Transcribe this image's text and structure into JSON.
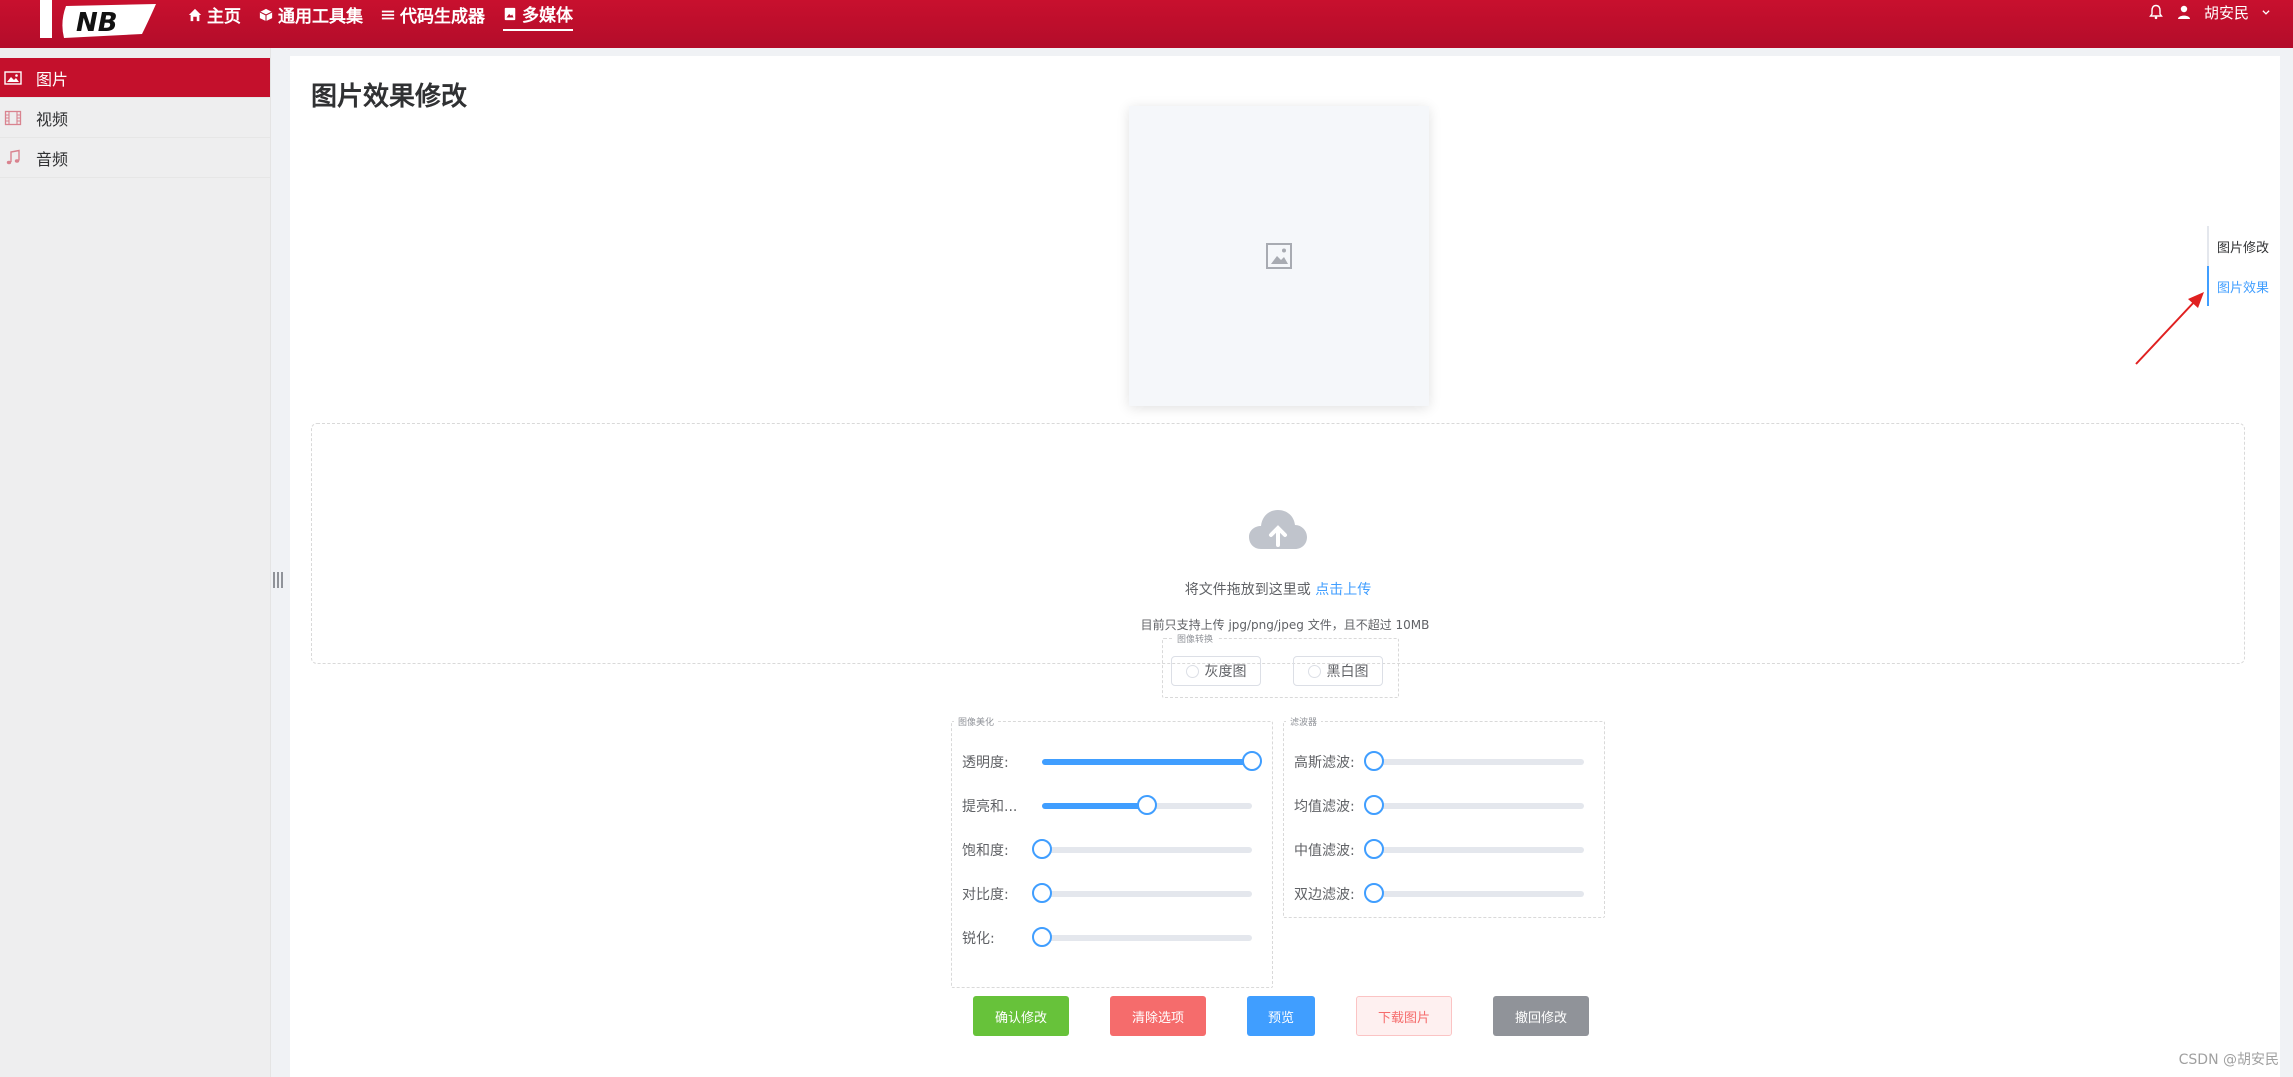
{
  "header": {
    "logo_text": "NB",
    "nav": [
      {
        "label": "主页",
        "icon": "home-icon"
      },
      {
        "label": "通用工具集",
        "icon": "cube-icon"
      },
      {
        "label": "代码生成器",
        "icon": "list-icon"
      },
      {
        "label": "多媒体",
        "icon": "media-icon"
      }
    ],
    "user_name": "胡安民"
  },
  "sidebar": {
    "items": [
      {
        "label": "图片",
        "icon": "image-icon"
      },
      {
        "label": "视频",
        "icon": "film-icon"
      },
      {
        "label": "音频",
        "icon": "music-icon"
      }
    ]
  },
  "main": {
    "title": "图片效果修改",
    "upload": {
      "text": "将文件拖放到这里或 ",
      "link": "点击上传",
      "tip": "目前只支持上传 jpg/png/jpeg 文件，且不超过 10MB"
    },
    "convert": {
      "legend": "图像转换",
      "options": [
        "灰度图",
        "黑白图"
      ]
    },
    "beauty": {
      "legend": "图像美化",
      "sliders": [
        {
          "label": "透明度:",
          "value": 100
        },
        {
          "label": "提亮和...",
          "value": 50
        },
        {
          "label": "饱和度:",
          "value": 0
        },
        {
          "label": "对比度:",
          "value": 0
        },
        {
          "label": "锐化:",
          "value": 0
        }
      ]
    },
    "filter": {
      "legend": "滤波器",
      "sliders": [
        {
          "label": "高斯滤波:",
          "value": 0
        },
        {
          "label": "均值滤波:",
          "value": 0
        },
        {
          "label": "中值滤波:",
          "value": 0
        },
        {
          "label": "双边滤波:",
          "value": 0
        }
      ]
    },
    "buttons": {
      "confirm": "确认修改",
      "clear": "清除选项",
      "preview": "预览",
      "download": "下载图片",
      "revert": "撤回修改"
    },
    "anchor": [
      "图片修改",
      "图片效果"
    ]
  },
  "watermark": "CSDN @胡安民",
  "colors": {
    "header": "#c8102e",
    "accent": "#409eff",
    "success": "#67c23a",
    "danger": "#f56c6c",
    "info": "#909399"
  }
}
